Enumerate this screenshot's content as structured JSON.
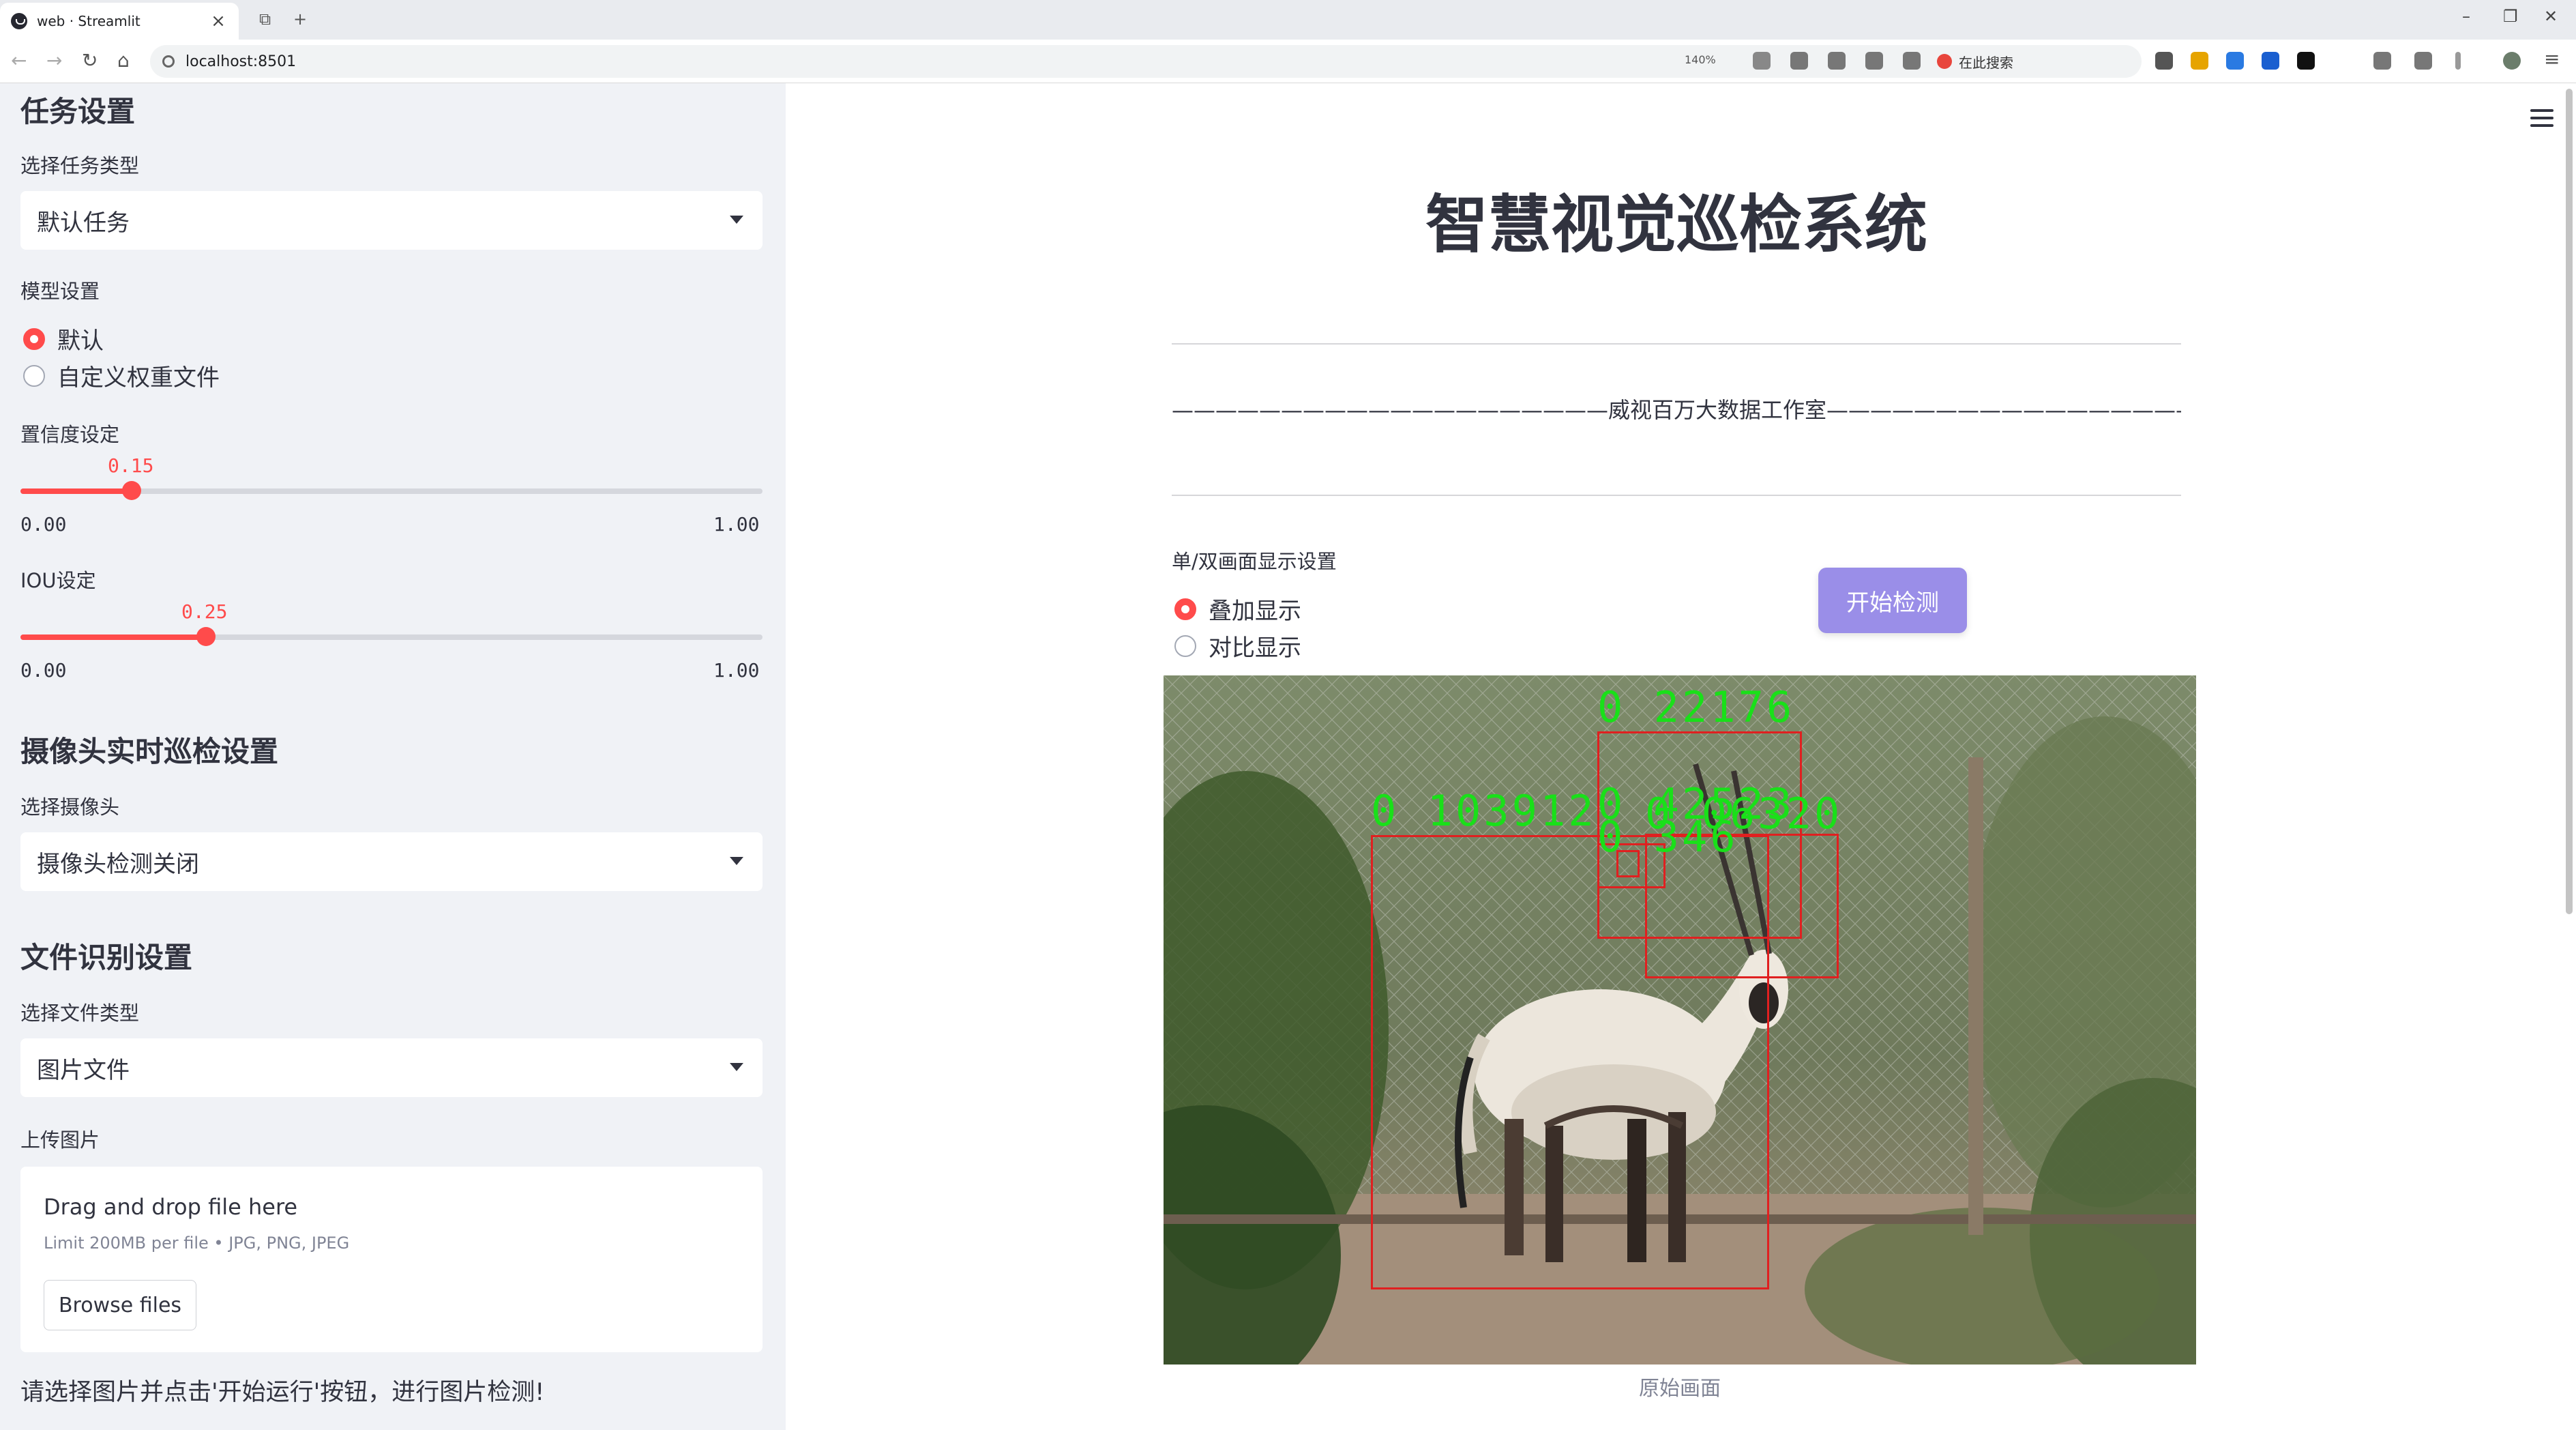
{
  "browser": {
    "tab_title": "web · Streamlit",
    "url": "localhost:8501",
    "zoom": "140%",
    "search_engine_label": "在此搜索"
  },
  "sidebar": {
    "task_heading": "任务设置",
    "task_type_label": "选择任务类型",
    "task_type_value": "默认任务",
    "model_label": "模型设置",
    "model_options": [
      "默认",
      "自定义权重文件"
    ],
    "model_selected": 0,
    "confidence_label": "置信度设定",
    "confidence": {
      "value": "0.15",
      "min": "0.00",
      "max": "1.00",
      "fraction": 0.15
    },
    "iou_label": "IOU设定",
    "iou": {
      "value": "0.25",
      "min": "0.00",
      "max": "1.00",
      "fraction": 0.25
    },
    "camera_heading": "摄像头实时巡检设置",
    "camera_label": "选择摄像头",
    "camera_value": "摄像头检测关闭",
    "file_heading": "文件识别设置",
    "file_type_label": "选择文件类型",
    "file_type_value": "图片文件",
    "upload_label": "上传图片",
    "uploader": {
      "title": "Drag and drop file here",
      "limit": "Limit 200MB per file • JPG, PNG, JPEG",
      "button": "Browse files"
    },
    "hint": "请选择图片并点击'开始运行'按钮，进行图片检测!"
  },
  "main": {
    "title": "智慧视觉巡检系统",
    "studio_line": "————————————————————威视百万大数据工作室—————————————————————",
    "display_label": "单/双画面显示设置",
    "display_options": [
      "叠加显示",
      "对比显示"
    ],
    "display_selected": 0,
    "start_button": "开始检测",
    "caption": "原始画面",
    "detection_labels": [
      "0 22176",
      "0 103912",
      "0 42523",
      "0 06320",
      "0 346"
    ]
  },
  "colors": {
    "accent": "#ff4b4b",
    "button": "#9a8ee8",
    "box": "#e02020",
    "label": "#19e019"
  }
}
